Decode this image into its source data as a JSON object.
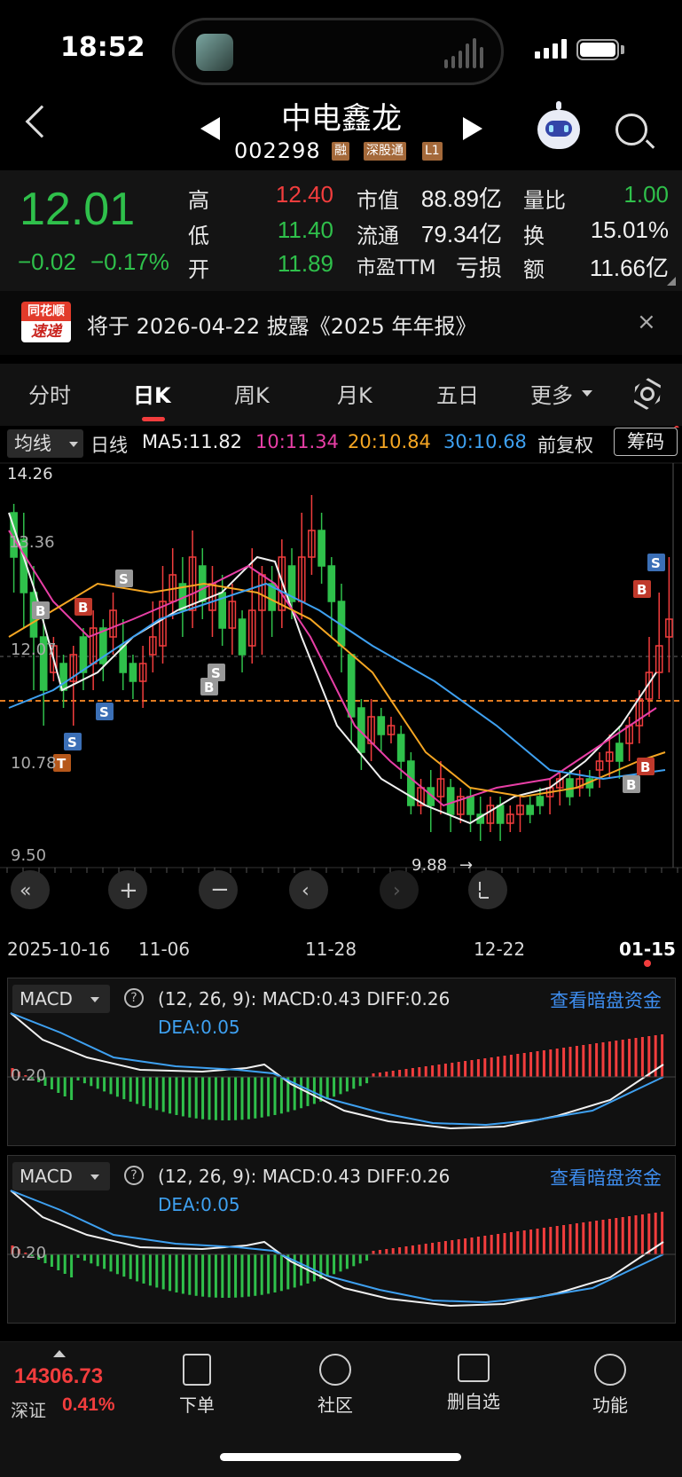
{
  "status": {
    "time": "18:52"
  },
  "header": {
    "stock_name": "中电鑫龙",
    "stock_code": "002298",
    "tags": [
      "融",
      "深股通",
      "L1"
    ]
  },
  "quote": {
    "price": "12.01",
    "change": "−0.02",
    "change_pct": "−0.17%",
    "rows": [
      {
        "l1": "高",
        "v1": "12.40",
        "l2": "市值",
        "v2": "88.89亿",
        "l3": "量比",
        "v3": "1.00"
      },
      {
        "l1": "低",
        "v1": "11.40",
        "l2": "流通",
        "v2": "79.34亿",
        "l3": "换",
        "v3": "15.01%"
      },
      {
        "l1": "开",
        "v1": "11.89",
        "l2": "市盈TTM",
        "v2": "亏损",
        "l3": "额",
        "v3": "11.66亿"
      }
    ]
  },
  "notice": {
    "logo_top": "同花顺",
    "logo_bottom": "速递",
    "text": "将于 2026-04-22 披露《2025 年年报》",
    "close": "×"
  },
  "tabs": [
    "分时",
    "日K",
    "周K",
    "月K",
    "五日",
    "更多"
  ],
  "ma": {
    "selector": "均线",
    "period": "日线",
    "ma5": "MA5:11.82",
    "ma10": "10:11.34",
    "ma20": "20:10.84",
    "ma30": "30:10.68",
    "adjust": "前复权",
    "chip": "筹码"
  },
  "colors": {
    "up": "#f23d3d",
    "down": "#2fc04b",
    "ma5": "#f0f0f0",
    "ma10": "#e83fa6",
    "ma20": "#f5a623",
    "ma30": "#3ea0f0"
  },
  "chart_data": {
    "type": "table",
    "price_labels": [
      "14.26",
      "13.36",
      "12.07",
      "10.78",
      "9.50"
    ],
    "high_marker": "14.26",
    "low_marker": "9.88",
    "dates": [
      "2025-10-16",
      "11-06",
      "11-28",
      "12-22",
      "01-15"
    ],
    "signal_marks": [
      "B",
      "B",
      "S",
      "S",
      "B",
      "S",
      "T",
      "S",
      "B",
      "B",
      "S",
      "B"
    ]
  },
  "macd": {
    "selector": "MACD",
    "params": "(12, 26, 9):  MACD:0.43  DIFF:0.26",
    "dea": "DEA:0.05",
    "link": "查看暗盘资金",
    "level": "0.20"
  },
  "bottom": {
    "index_value": "14306.73",
    "index_name": "深证",
    "index_pct": "0.41%",
    "nav": [
      "下单",
      "社区",
      "删自选",
      "功能"
    ]
  }
}
